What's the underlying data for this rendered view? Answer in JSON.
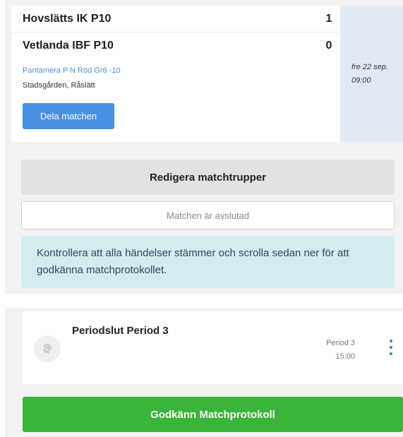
{
  "match": {
    "home_team": "Hovslätts IK P10",
    "home_score": "1",
    "away_team": "Vetlanda IBF P10",
    "away_score": "0",
    "league": "Pantamera P N Röd Gr6 -10",
    "venue": "Stadsgården, Råslätt",
    "share_label": "Dela matchen",
    "date": "fre 22 sep.",
    "time": "09:00"
  },
  "actions": {
    "edit_label": "Redigera matchtrupper",
    "status_text": "Matchen är avslutad",
    "info_text": "Kontrollera att alla händelser stämmer och scrolla sedan ner för att godkänna matchprotokollet."
  },
  "event": {
    "title": "Periodslut Period 3",
    "period": "Period 3",
    "time": "15:00",
    "icon": "fingerprint-icon",
    "menu_icon": "more-vertical-icon"
  },
  "approve": {
    "label": "Godkänn Matchprotokoll"
  },
  "colors": {
    "primary": "#4a90e2",
    "success": "#3ab53a",
    "info_bg": "#d2ecf1",
    "date_bg": "#e1eaf4"
  }
}
